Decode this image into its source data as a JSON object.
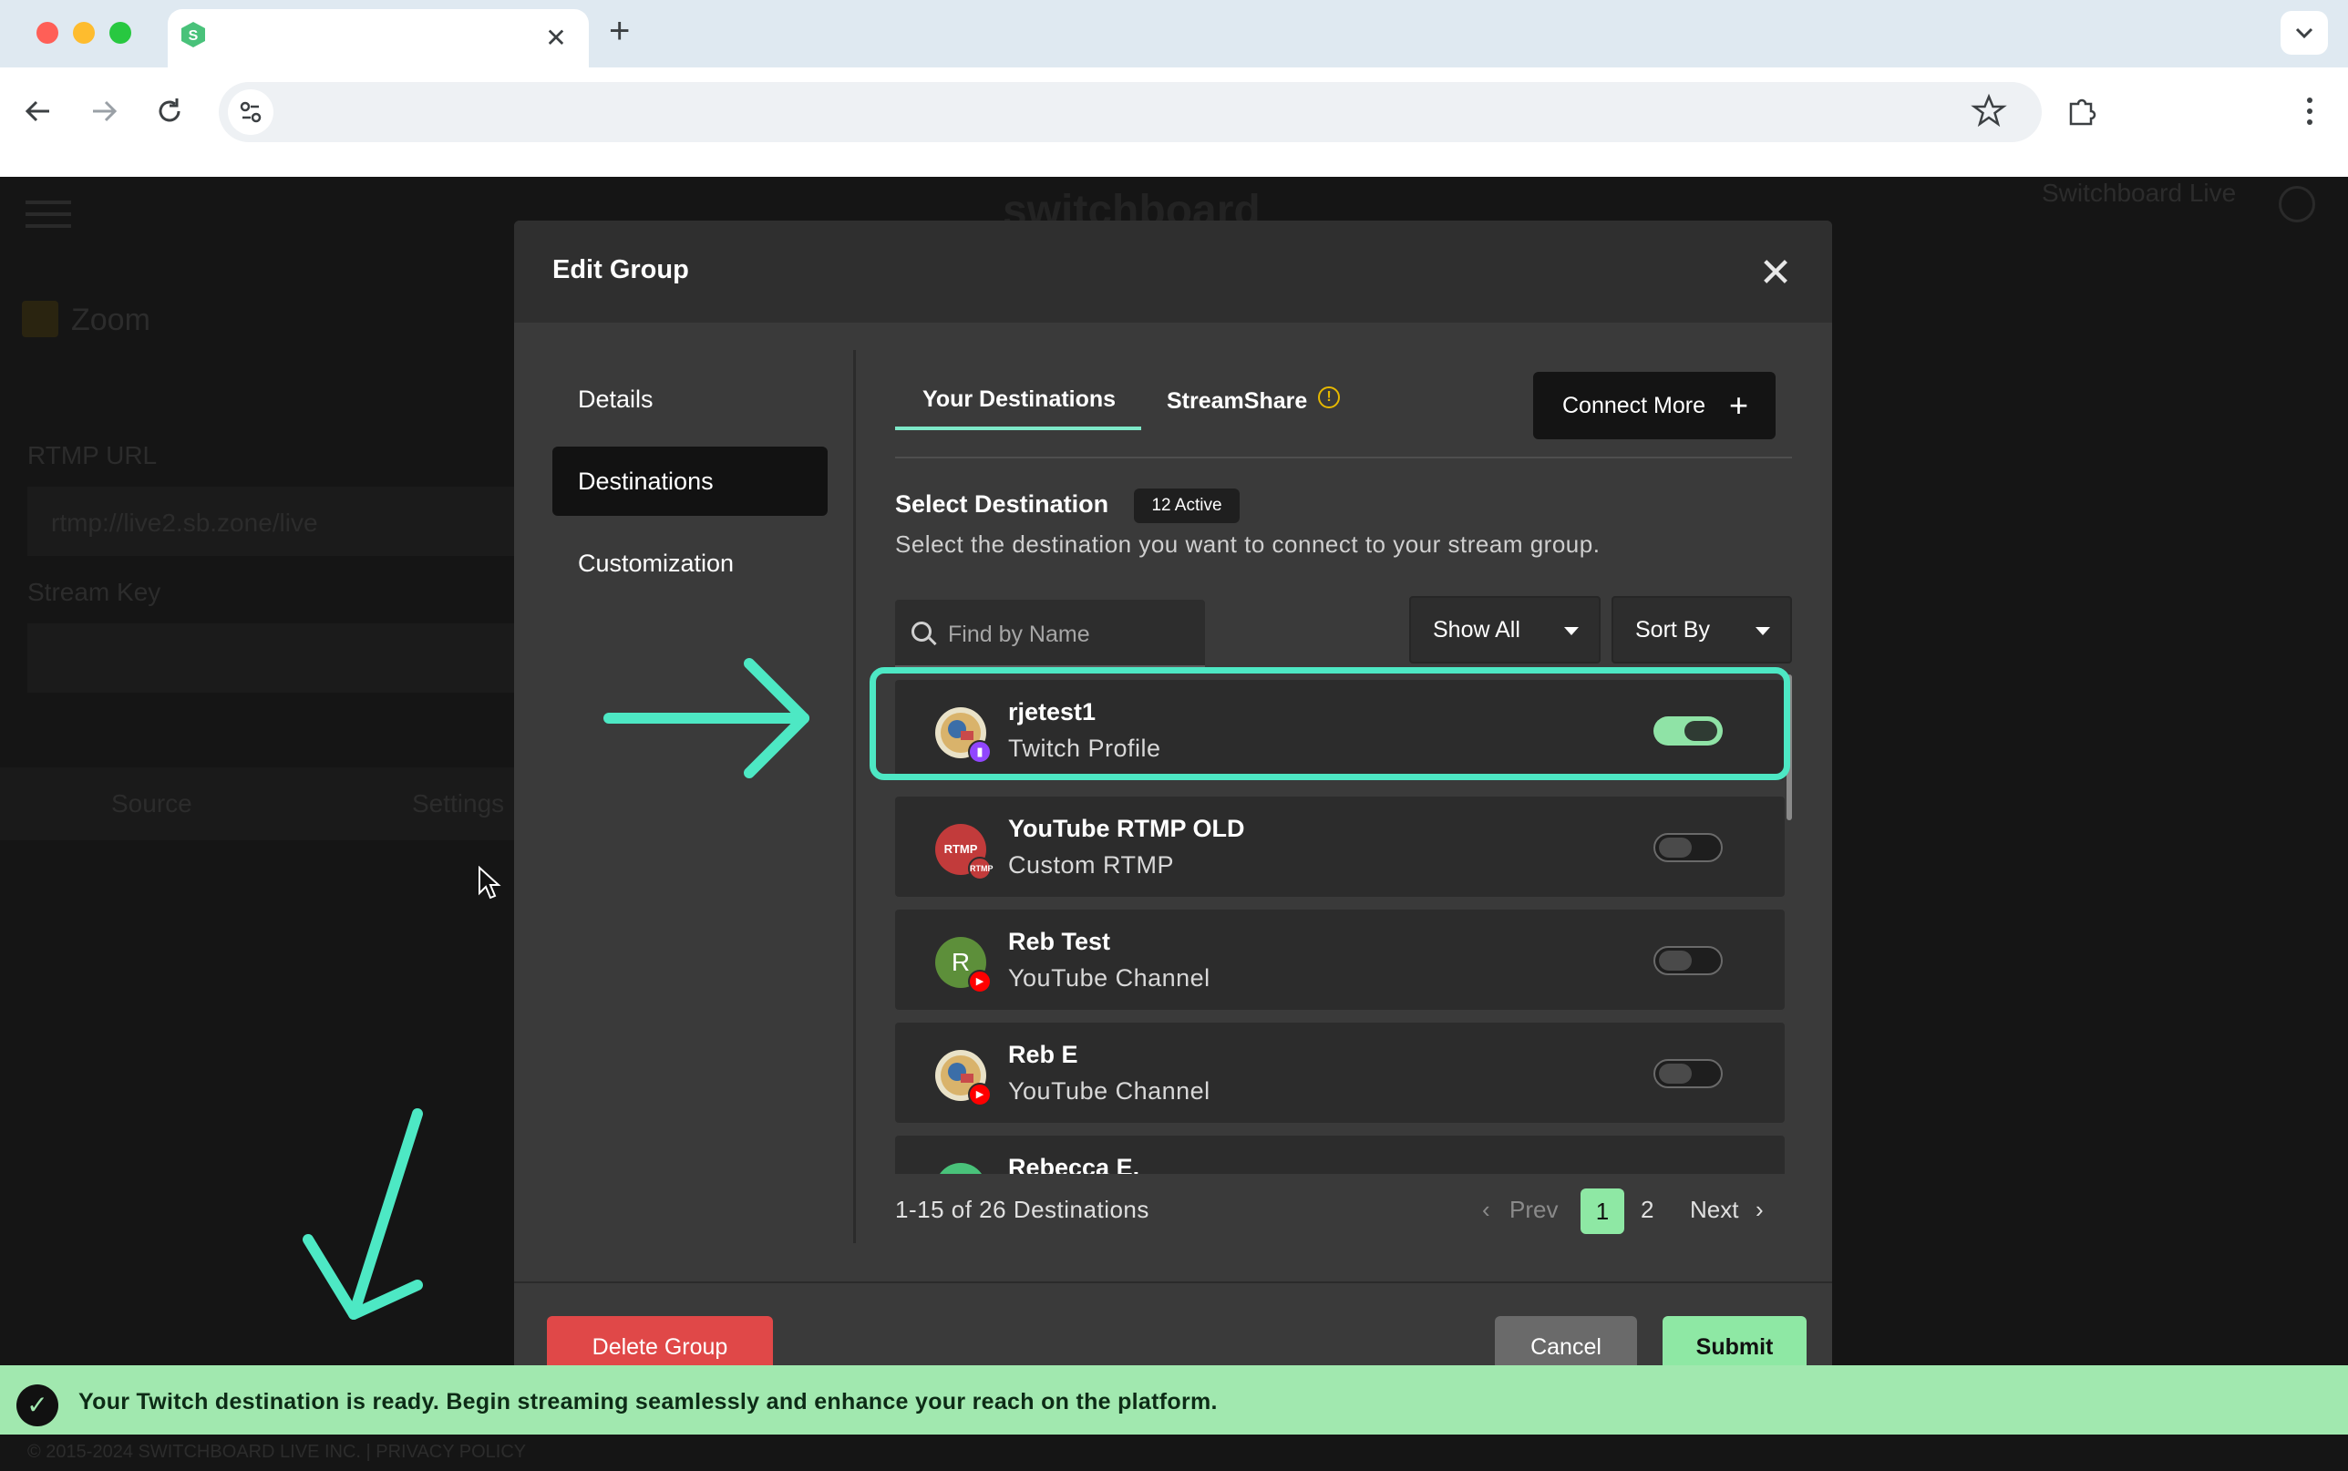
{
  "browser": {
    "new_tab_symbol": "+",
    "tab_close_symbol": "✕",
    "address_value": "",
    "icons": [
      "back-arrow-icon",
      "forward-arrow-icon",
      "reload-icon",
      "site-settings-icon",
      "bookmark-star-icon",
      "extensions-icon",
      "kebab-menu-icon",
      "tab-search-chevron-icon"
    ]
  },
  "background_app": {
    "brand": "switchboard",
    "account": "Switchboard Live",
    "stream_name": "Zoom",
    "rtmp_url_label": "RTMP URL",
    "rtmp_url_value": "rtmp://live2.sb.zone/live",
    "stream_key_label": "Stream Key",
    "tabs": [
      "Source",
      "Settings"
    ],
    "footer": "© 2015-2024 SWITCHBOARD LIVE INC. | PRIVACY POLICY"
  },
  "modal": {
    "title": "Edit Group",
    "close_symbol": "✕",
    "nav": [
      "Details",
      "Destinations",
      "Customization"
    ],
    "active_nav": "Destinations",
    "tabs": {
      "your_destinations": "Your Destinations",
      "streamshare": "StreamShare",
      "info_symbol": "!"
    },
    "connect_more": "Connect More",
    "connect_more_symbol": "+",
    "select_title": "Select Destination",
    "active_badge": "12 Active",
    "select_desc": "Select the destination you want to connect to your stream group.",
    "search_placeholder": "Find by Name",
    "filter": "Show All",
    "sort": "Sort By",
    "destinations": [
      {
        "name": "rjetest1",
        "type": "Twitch Profile",
        "enabled": true,
        "platform": "twitch"
      },
      {
        "name": "YouTube RTMP OLD",
        "type": "Custom RTMP",
        "enabled": false,
        "platform": "rtmp",
        "avatar_text": "RTMP",
        "sub_text": "RTMP"
      },
      {
        "name": "Reb Test",
        "type": "YouTube Channel",
        "enabled": false,
        "platform": "youtube",
        "avatar_text": "R"
      },
      {
        "name": "Reb E",
        "type": "YouTube Channel",
        "enabled": false,
        "platform": "youtube"
      },
      {
        "name": "Rebecca E.",
        "type": "",
        "enabled": false,
        "platform": "switchboard"
      }
    ],
    "pagination": {
      "summary": "1-15 of 26 Destinations",
      "prev": "Prev",
      "prev_symbol": "‹",
      "pages": [
        "1",
        "2"
      ],
      "current": "1",
      "next": "Next",
      "next_symbol": "›"
    },
    "delete_group": "Delete Group",
    "cancel": "Cancel",
    "submit": "Submit"
  },
  "toast": {
    "check_symbol": "✓",
    "message": "Your Twitch destination is ready. Begin streaming seamlessly and enhance your reach on the platform."
  },
  "colors": {
    "accent_teal": "#4de8c4",
    "toggle_on": "#8fe3a6",
    "toast_bg": "#a1e8af",
    "delete_red": "#e04848",
    "submit_green": "#8ee8a4"
  }
}
